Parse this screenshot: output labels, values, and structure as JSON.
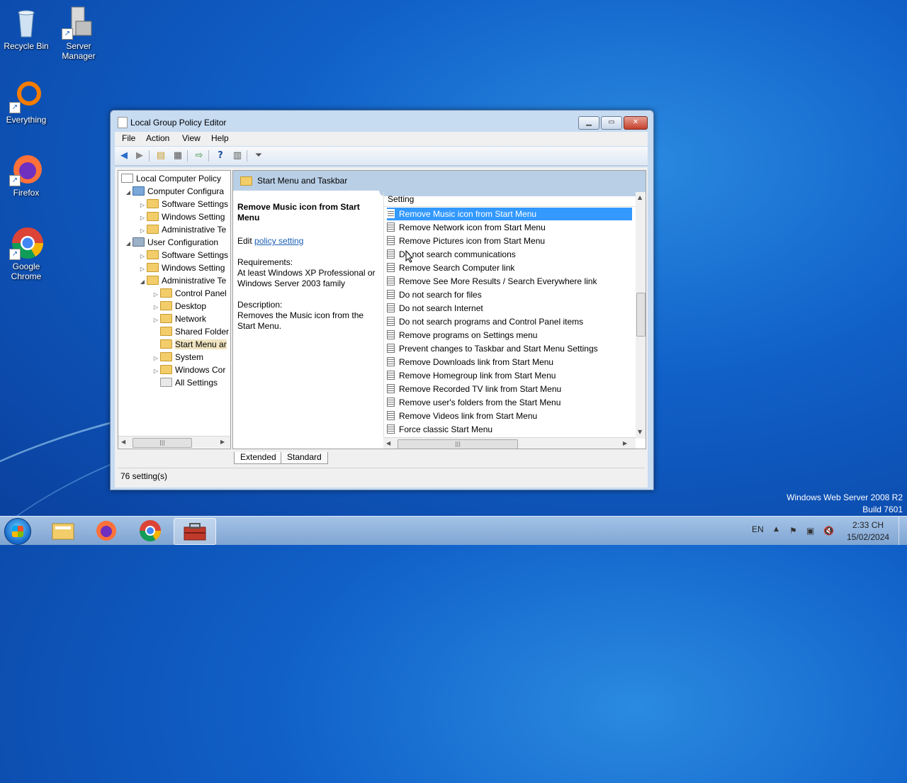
{
  "desktop": {
    "icons": [
      {
        "label": "Recycle Bin"
      },
      {
        "label": "Server Manager"
      },
      {
        "label": "Everything"
      },
      {
        "label": "Firefox"
      },
      {
        "label": "Google Chrome"
      }
    ],
    "watermark_line1": "Windows Web Server 2008 R2",
    "watermark_line2": "Build 7601"
  },
  "window": {
    "title": "Local Group Policy Editor",
    "menu": [
      "File",
      "Action",
      "View",
      "Help"
    ],
    "tree": [
      {
        "label": "Local Computer Policy"
      },
      {
        "label": "Computer Configura"
      },
      {
        "label": "Software Settings"
      },
      {
        "label": "Windows Setting"
      },
      {
        "label": "Administrative Te"
      },
      {
        "label": "User Configuration"
      },
      {
        "label": "Software Settings"
      },
      {
        "label": "Windows Setting"
      },
      {
        "label": "Administrative Te"
      },
      {
        "label": "Control Panel"
      },
      {
        "label": "Desktop"
      },
      {
        "label": "Network"
      },
      {
        "label": "Shared Folder"
      },
      {
        "label": "Start Menu ar"
      },
      {
        "label": "System"
      },
      {
        "label": "Windows Cor"
      },
      {
        "label": "All Settings"
      }
    ],
    "header_folder": "Start Menu and Taskbar",
    "description": {
      "title": "Remove Music icon from Start Menu",
      "edit_prefix": "Edit ",
      "edit_link": "policy setting",
      "requirements_label": "Requirements:",
      "requirements": "At least Windows XP Professional or Windows Server 2003 family",
      "description_label": "Description:",
      "description": "Removes the Music icon from the Start Menu."
    },
    "list_header": "Setting",
    "settings": [
      "Remove Music icon from Start Menu",
      "Remove Network icon from Start Menu",
      "Remove Pictures icon from Start Menu",
      "Do not search communications",
      "Remove Search Computer link",
      "Remove See More Results / Search Everywhere link",
      "Do not search for files",
      "Do not search Internet",
      "Do not search programs and Control Panel items",
      "Remove programs on Settings menu",
      "Prevent changes to Taskbar and Start Menu Settings",
      "Remove Downloads link from Start Menu",
      "Remove Homegroup link from Start Menu",
      "Remove Recorded TV link from Start Menu",
      "Remove user's folders from the Start Menu",
      "Remove Videos link from Start Menu",
      "Force classic Start Menu"
    ],
    "selected_setting_index": 0,
    "tabs": [
      "Extended",
      "Standard"
    ],
    "status": "76 setting(s)"
  },
  "taskbar": {
    "language": "EN",
    "time": "2:33 CH",
    "date": "15/02/2024"
  },
  "icons": [
    "back-icon",
    "forward-icon",
    "up-folder-icon",
    "show-hide-tree-icon",
    "export-icon",
    "help-icon",
    "properties-icon",
    "filter-icon"
  ]
}
